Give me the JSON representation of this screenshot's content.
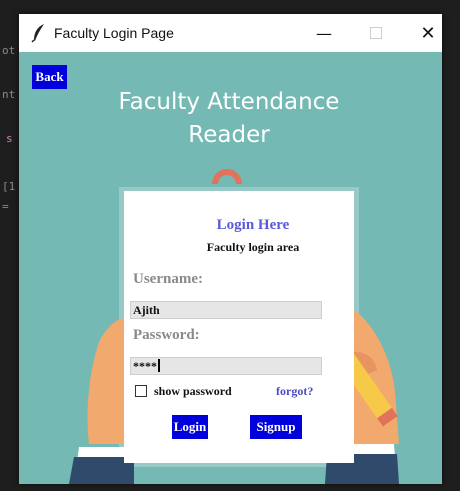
{
  "window": {
    "title": "Faculty Login Page",
    "icon": "feather-icon",
    "controls": {
      "minimize": "—",
      "close": "✕"
    }
  },
  "app": {
    "back_label": "Back",
    "heading_line1": "Faculty Attendance",
    "heading_line2": "Reader"
  },
  "form": {
    "title": "Login Here",
    "subtitle": "Faculty login area",
    "username_label": "Username:",
    "username_value": "Ajith",
    "password_label": "Password:",
    "password_value": "****",
    "show_password_label": "show password",
    "show_password_checked": false,
    "forgot_label": "forgot?",
    "login_label": "Login",
    "signup_label": "Signup"
  },
  "colors": {
    "background": "#74b9b3",
    "button": "#0000dd",
    "title_accent": "#5a5ad8"
  }
}
